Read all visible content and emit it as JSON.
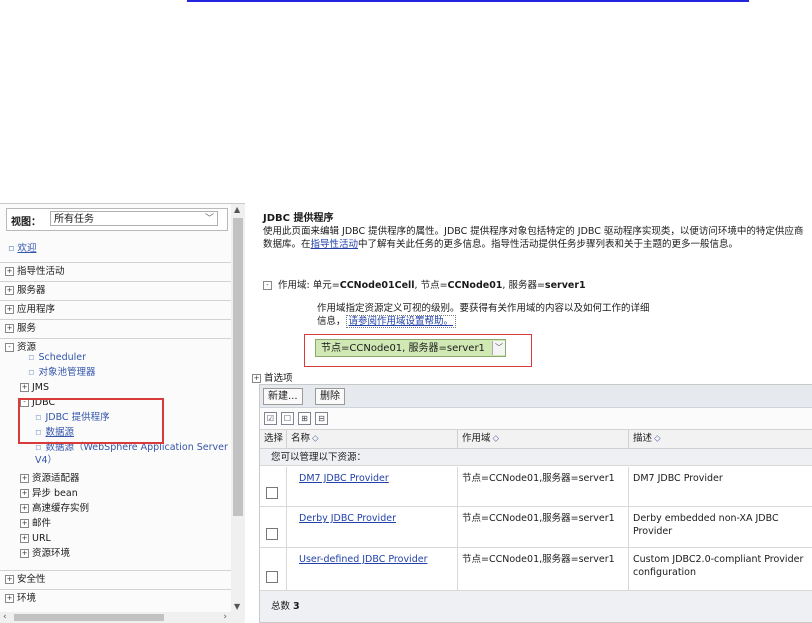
{
  "nav": {
    "view_label": "视图：",
    "view_value": "所有任务",
    "welcome": "欢迎",
    "items": [
      {
        "label": "指导性活动",
        "toggle": "+"
      },
      {
        "label": "服务器",
        "toggle": "+"
      },
      {
        "label": "应用程序",
        "toggle": "+"
      },
      {
        "label": "服务",
        "toggle": "+"
      },
      {
        "label": "资源",
        "toggle": "-"
      }
    ],
    "resources": {
      "scheduler": "Scheduler",
      "object_pool": "对象池管理器",
      "jms": "JMS",
      "jdbc": "JDBC",
      "jdbc_provider": "JDBC 提供程序",
      "datasource": "数据源",
      "datasource_v4": "数据源（WebSphere Application Server V4）",
      "adapters": "资源适配器",
      "async_bean": "异步 bean",
      "cache": "高速缓存实例",
      "mail": "邮件",
      "url": "URL",
      "env": "资源环境"
    },
    "bottom_items": [
      {
        "label": "安全性",
        "toggle": "+"
      },
      {
        "label": "环境",
        "toggle": "+"
      }
    ]
  },
  "main": {
    "title": "JDBC 提供程序",
    "intro_1": "使用此页面来编辑 JDBC 提供程序的属性。JDBC 提供程序对象包括特定的 JDBC 驱动程序实现类，以便访问环境中的特定供应商数据库。在",
    "intro_link": "指导性活动",
    "intro_2": "中了解有关此任务的更多信息。指导性活动提供任务步骤列表和关于主题的更多一般信息。",
    "scope_prefix": "作用域: 单元=",
    "scope_cell": "CCNode01Cell",
    "scope_node_label": ", 节点=",
    "scope_node": "CCNode01",
    "scope_server_label": ", 服务器=",
    "scope_server": "server1",
    "scope_desc_1": "作用域指定资源定义可视的级别。要获得有关作用域的内容以及如何工作的详细",
    "scope_desc_2": "信息，",
    "scope_help_link": "请参阅作用域设置帮助。",
    "scope_select": "节点=CCNode01, 服务器=server1",
    "preferences": "首选项",
    "new_button": "新建...",
    "delete_button": "删除",
    "columns": {
      "select": "选择",
      "name": "名称",
      "scope": "作用域",
      "description": "描述"
    },
    "manage_text": "您可以管理以下资源：",
    "rows": [
      {
        "name": "DM7 JDBC Provider",
        "scope": "节点=CCNode01,服务器=server1",
        "description": "DM7 JDBC Provider"
      },
      {
        "name": "Derby JDBC Provider",
        "scope": "节点=CCNode01,服务器=server1",
        "description": "Derby embedded non-XA JDBC Provider"
      },
      {
        "name": "User-defined JDBC Provider",
        "scope": "节点=CCNode01,服务器=server1",
        "description": "Custom JDBC2.0-compliant Provider configuration"
      }
    ],
    "total_label": "总数",
    "total_value": "3"
  },
  "colors": {
    "accent_line": "#2424e0",
    "highlight_box": "#d93b3b",
    "scope_select_bg": "#cfe8b4",
    "link": "#2241a8"
  }
}
